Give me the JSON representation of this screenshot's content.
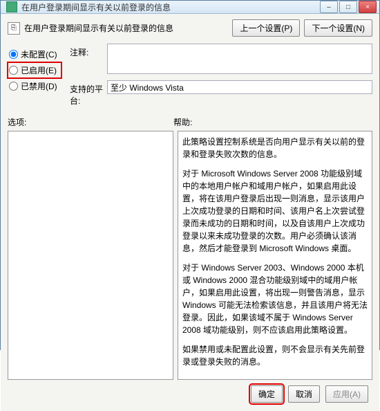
{
  "window": {
    "title": "在用户登录期间显示有关以前登录的信息",
    "min_icon": "–",
    "max_icon": "□",
    "close_icon": "×"
  },
  "header": {
    "title": "在用户登录期间显示有关以前登录的信息",
    "prev_btn": "上一个设置(P)",
    "next_btn": "下一个设置(N)"
  },
  "radios": {
    "not_configured": "未配置(C)",
    "enabled": "已启用(E)",
    "disabled": "已禁用(D)",
    "selected": "not_configured"
  },
  "form": {
    "comment_label": "注释:",
    "comment_value": "",
    "platform_label": "支持的平台:",
    "platform_value": "至少 Windows Vista"
  },
  "labels": {
    "options": "选项:",
    "help": "帮助:"
  },
  "help_text": {
    "p1": "此策略设置控制系统是否向用户显示有关以前的登录和登录失败次数的信息。",
    "p2": "对于 Microsoft Windows Server 2008 功能级别域中的本地用户帐户和域用户帐户，如果启用此设置，将在该用户登录后出现一则消息，显示该用户上次成功登录的日期和时间、该用户名上次尝试登录而未成功的日期和时间，以及自该用户上次成功登录以来未成功登录的次数。用户必须确认该消息，然后才能登录到 Microsoft Windows 桌面。",
    "p3": "对于 Windows Server 2003、Windows 2000 本机或 Windows 2000 混合功能级别域中的域用户帐户，如果启用此设置，将出现一则警告消息，显示 Windows 可能无法检索该信息，并且该用户将无法登录。因此，如果该域不属于 Windows Server 2008 域功能级别，则不应该启用此策略设置。",
    "p4": "如果禁用或未配置此设置，则不会显示有关先前登录或登录失败的消息。"
  },
  "footer": {
    "ok": "确定",
    "cancel": "取消",
    "apply": "应用(A)"
  }
}
